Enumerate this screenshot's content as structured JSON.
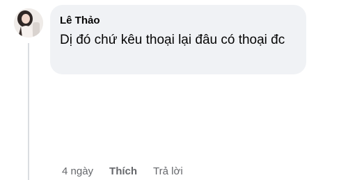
{
  "comment": {
    "author": "Lê Thảo",
    "text": "Dị đó chứ kêu thoại lại đâu có thoại đc",
    "timestamp": "4 ngày",
    "like_label": "Thích",
    "reply_label": "Trả lời"
  }
}
